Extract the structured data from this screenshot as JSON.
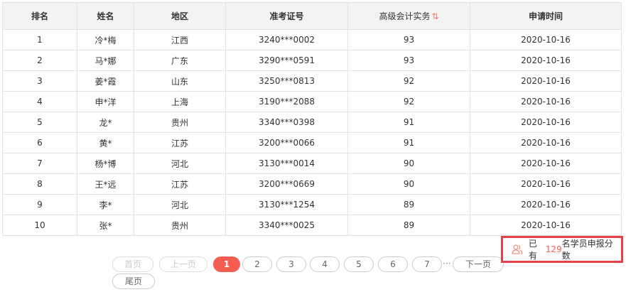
{
  "table": {
    "headers": [
      "排名",
      "姓名",
      "地区",
      "准考证号",
      "高级会计实务",
      "申请时间"
    ],
    "sort_icon": "sort-arrows-icon",
    "rows": [
      [
        "1",
        "冷*梅",
        "江西",
        "3240***0002",
        "93",
        "2020-10-16"
      ],
      [
        "2",
        "马*娜",
        "广东",
        "3290***0591",
        "93",
        "2020-10-16"
      ],
      [
        "3",
        "姜*霞",
        "山东",
        "3250***0813",
        "92",
        "2020-10-16"
      ],
      [
        "4",
        "申*洋",
        "上海",
        "3190***2088",
        "92",
        "2020-10-16"
      ],
      [
        "5",
        "龙*",
        "贵州",
        "3340***0398",
        "91",
        "2020-10-16"
      ],
      [
        "6",
        "黄*",
        "江苏",
        "3200***0066",
        "91",
        "2020-10-16"
      ],
      [
        "7",
        "杨*博",
        "河北",
        "3130***0014",
        "90",
        "2020-10-16"
      ],
      [
        "8",
        "王*远",
        "江苏",
        "3200***0669",
        "90",
        "2020-10-16"
      ],
      [
        "9",
        "李*",
        "河北",
        "3130***1254",
        "89",
        "2020-10-16"
      ],
      [
        "10",
        "张*",
        "贵州",
        "3340***0025",
        "89",
        "2020-10-16"
      ]
    ]
  },
  "pagination": {
    "first": "首页",
    "prev": "上一页",
    "pages": [
      "1",
      "2",
      "3",
      "4",
      "5",
      "6",
      "7"
    ],
    "current": "1",
    "ellipsis": "···",
    "next": "下一页",
    "last": "尾页"
  },
  "notice": {
    "prefix": "已有",
    "count": "129",
    "suffix": "名学员申报分数",
    "icon": "users-icon"
  },
  "colors": {
    "accent": "#f45d4f",
    "highlight_border": "#e8404a"
  }
}
